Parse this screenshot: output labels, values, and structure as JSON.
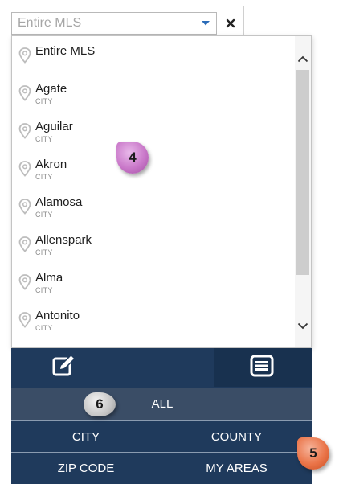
{
  "select": {
    "value": "Entire MLS"
  },
  "list": {
    "items": [
      {
        "name": "Entire MLS",
        "type": ""
      },
      {
        "name": "Agate",
        "type": "CITY"
      },
      {
        "name": "Aguilar",
        "type": "CITY"
      },
      {
        "name": "Akron",
        "type": "CITY"
      },
      {
        "name": "Alamosa",
        "type": "CITY"
      },
      {
        "name": "Allenspark",
        "type": "CITY"
      },
      {
        "name": "Alma",
        "type": "CITY"
      },
      {
        "name": "Antonito",
        "type": "CITY"
      }
    ]
  },
  "callouts": {
    "list_badge": "4",
    "filter_badge": "5",
    "all_badge": "6"
  },
  "toolbar": {
    "draw_icon": "pencil-square-icon",
    "list_icon": "list-icon"
  },
  "filters": {
    "all_label": "ALL",
    "city_label": "CITY",
    "county_label": "COUNTY",
    "zip_label": "ZIP CODE",
    "areas_label": "MY AREAS"
  },
  "colors": {
    "toolbar_navy": "#1f3a5c",
    "all_row": "#3a4d66",
    "select_arrow": "#2b6cb8",
    "badge_purple": "#c978c9",
    "badge_orange": "#ea7448",
    "badge_gray": "#c6c6c6"
  }
}
